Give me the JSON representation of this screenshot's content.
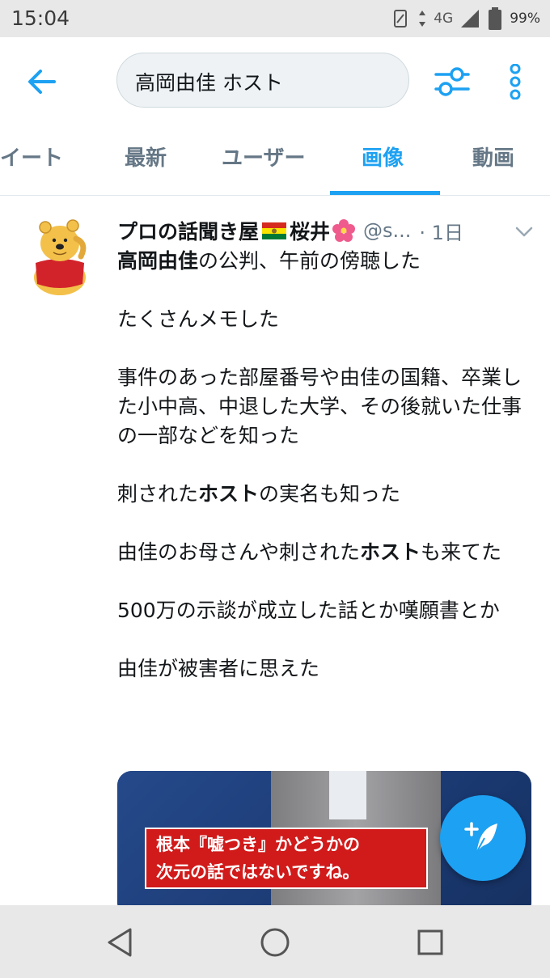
{
  "status_bar": {
    "time": "15:04",
    "network": "4G",
    "battery": "99%"
  },
  "app_bar": {
    "search_query": "高岡由佳 ホスト",
    "icons": [
      "back-arrow-icon",
      "filter-sliders-icon",
      "more-vert-icon"
    ]
  },
  "tabs": [
    {
      "label": "ツイート",
      "active": false
    },
    {
      "label": "最新",
      "active": false
    },
    {
      "label": "ユーザー",
      "active": false
    },
    {
      "label": "画像",
      "active": true
    },
    {
      "label": "動画",
      "active": false
    }
  ],
  "tweet": {
    "display_name": "プロの話聞き屋",
    "display_name_suffix": "桜井",
    "handle": "@s...",
    "time": "· 1日",
    "paragraphs": [
      [
        {
          "text": "高岡由佳",
          "bold": true
        },
        {
          "text": "の公判、午前の傍聴した",
          "bold": false
        }
      ],
      [
        {
          "text": "たくさんメモした",
          "bold": false
        }
      ],
      [
        {
          "text": "事件のあった部屋番号や由佳の国籍、卒業した小中高、中退した大学、その後就いた仕事の一部などを知った",
          "bold": false
        }
      ],
      [
        {
          "text": "刺された",
          "bold": false
        },
        {
          "text": "ホスト",
          "bold": true
        },
        {
          "text": "の実名も知った",
          "bold": false
        }
      ],
      [
        {
          "text": "由佳のお母さんや刺された",
          "bold": false
        },
        {
          "text": "ホスト",
          "bold": true
        },
        {
          "text": "も来てた",
          "bold": false
        }
      ],
      [
        {
          "text": "500万の示談が成立した話とか嘆願書とか",
          "bold": false
        }
      ],
      [
        {
          "text": "由佳が被害者に思えた",
          "bold": false
        }
      ]
    ],
    "media_caption_line1": "根本『嘘つき』かどうかの",
    "media_caption_line2": "次元の話ではないですね。"
  },
  "fab": {
    "icon": "compose-tweet-icon"
  },
  "nav_bar": {
    "icons": [
      "nav-back-icon",
      "nav-home-icon",
      "nav-recents-icon"
    ]
  },
  "colors": {
    "accent": "#1da1f2",
    "text": "#14171a",
    "secondary_text": "#657786",
    "caption_red": "#d11a1a"
  }
}
